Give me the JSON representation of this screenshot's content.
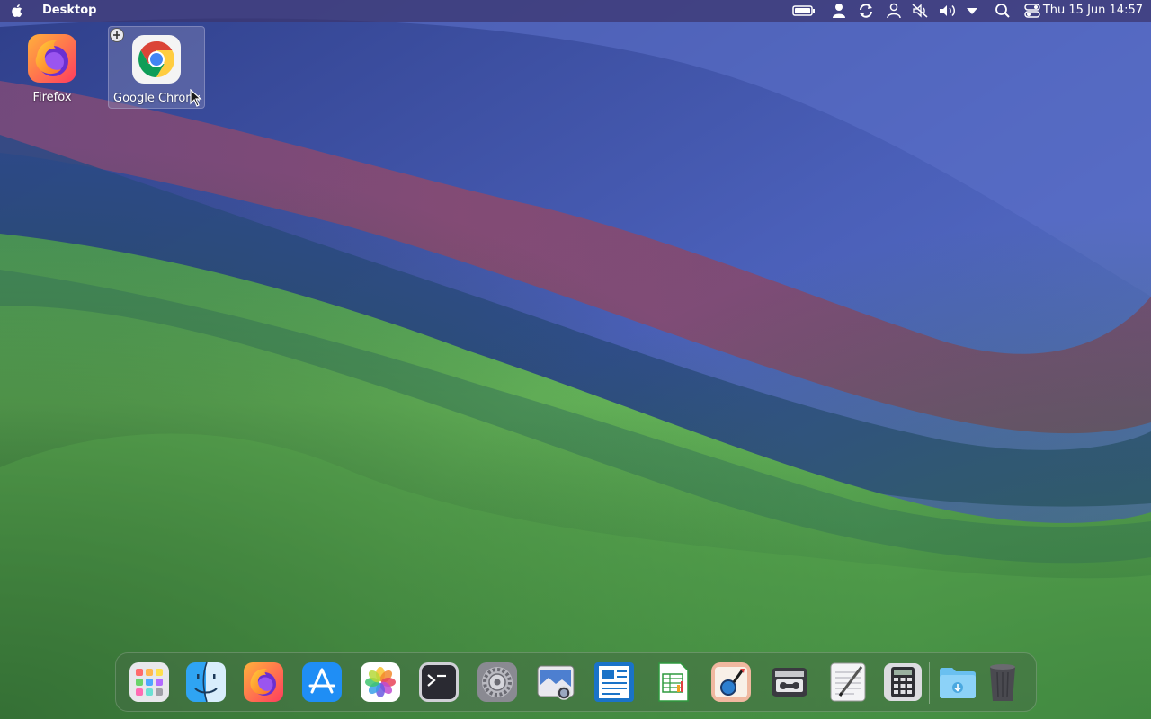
{
  "menubar": {
    "app_name": "Desktop",
    "clock": "Thu 15 Jun 14:57",
    "tray_icons": [
      "battery-icon",
      "user-icon",
      "sync-icon",
      "account-icon",
      "mute-icon",
      "volume-icon",
      "dropdown-arrow-icon",
      "search-icon",
      "control-center-icon"
    ]
  },
  "desktop_icons": [
    {
      "name": "firefox",
      "label": "Firefox",
      "selected": false
    },
    {
      "name": "google-chrome",
      "label": "Google Chrome",
      "selected": true
    }
  ],
  "dock": {
    "items": [
      "launchpad",
      "finder",
      "firefox",
      "app-store",
      "photos",
      "terminal",
      "system-settings",
      "image-viewer",
      "document-writer",
      "spreadsheet",
      "image-editor",
      "tape-recorder",
      "text-editor",
      "calculator",
      "downloads-folder",
      "trash"
    ]
  },
  "colors": {
    "menubar": "#3c346e",
    "label_text": "#ffffff",
    "dock_tint": "#466e46"
  }
}
